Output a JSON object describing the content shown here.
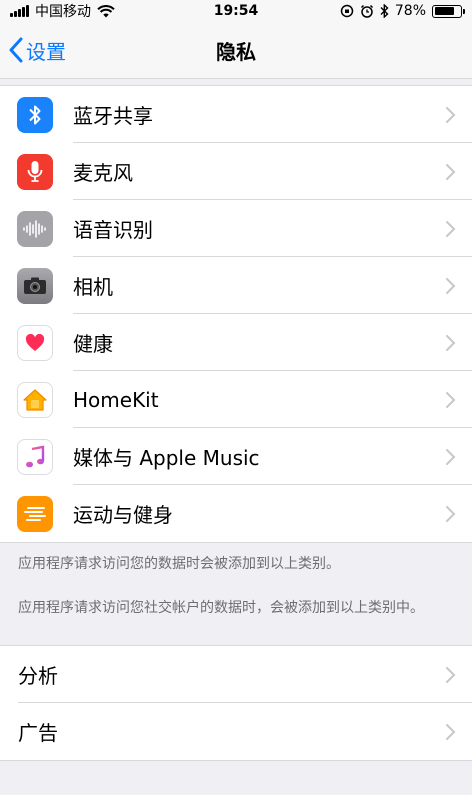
{
  "status": {
    "carrier": "中国移动",
    "time": "19:54",
    "battery": "78%",
    "battery_level": 0.78
  },
  "nav": {
    "back_label": "设置",
    "title": "隐私"
  },
  "rows": [
    {
      "label": "蓝牙共享",
      "icon": "bluetooth-icon",
      "color": "#1a82fb"
    },
    {
      "label": "麦克风",
      "icon": "microphone-icon",
      "color": "#f23a2f"
    },
    {
      "label": "语音识别",
      "icon": "speech-recognition-icon",
      "color": "#a3a3a8"
    },
    {
      "label": "相机",
      "icon": "camera-icon",
      "color": "#8e8e93"
    },
    {
      "label": "健康",
      "icon": "health-heart-icon",
      "color": "#ffffff"
    },
    {
      "label": "HomeKit",
      "icon": "homekit-house-icon",
      "color": "#ffffff"
    },
    {
      "label": "媒体与 Apple Music",
      "icon": "music-note-icon",
      "color": "#ffffff"
    },
    {
      "label": "运动与健身",
      "icon": "motion-fitness-icon",
      "color": "#ff9500"
    }
  ],
  "footnotes": {
    "first": "应用程序请求访问您的数据时会被添加到以上类别。",
    "second": "应用程序请求访问您社交帐户的数据时，会被添加到以上类别中。"
  },
  "bottom_rows": [
    {
      "label": "分析"
    },
    {
      "label": "广告"
    }
  ]
}
